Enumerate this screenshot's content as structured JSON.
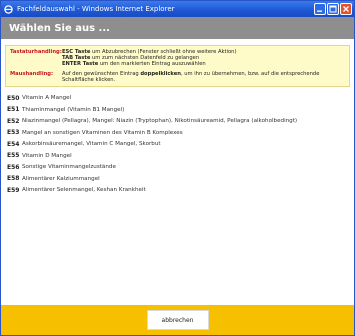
{
  "window": {
    "title": "Fachfeldauswahl - Windows Internet Explorer"
  },
  "header": {
    "title": "Wählen Sie aus ..."
  },
  "instructions": {
    "keyboard": {
      "heading": "Tastaturhandling:",
      "line1_key": "ESC Taste",
      "line1_text": " um Abzubrechen (Fenster schließt ohne weitere Aktion)",
      "line2_key": "TAB Taste",
      "line2_text": " um zum nächsten Datenfeld zu gelangen",
      "line3_key": "ENTER Taste",
      "line3_text": " um den markierten Eintrag auszuwählen"
    },
    "mouse": {
      "heading": "Maushandling:",
      "text1": "Auf den gewünschten Eintrag ",
      "key": "doppelklicken",
      "text2": ", um ihn zu übernehmen, bzw. auf die entsprechende Schaltfläche klicken."
    }
  },
  "items": [
    {
      "code": "E50",
      "desc": "Vitamin A Mangel"
    },
    {
      "code": "E51",
      "desc": "Thiaminmangel (Vitamin B1 Mangel)"
    },
    {
      "code": "E52",
      "desc": "Niazinmangel (Pellagra), Mangel: Niazin (Tryptophan), Nikotinsäureamid, Pellagra (alkoholbedingt)"
    },
    {
      "code": "E53",
      "desc": "Mangel an sonstigen Vitaminen des Vitamin B Komplexes"
    },
    {
      "code": "E54",
      "desc": "Askorbinsäuremangel, Vitamin C Mangel, Skorbut"
    },
    {
      "code": "E55",
      "desc": "Vitamin D Mangel"
    },
    {
      "code": "E56",
      "desc": "Sonstige Vitaminmangelzustände"
    },
    {
      "code": "E58",
      "desc": "Alimentärer Kalziummangel"
    },
    {
      "code": "E59",
      "desc": "Alimentärer Selenmangel, Keshan Krankheit"
    }
  ],
  "footer": {
    "cancel_label": "abbrechen"
  },
  "colors": {
    "header_bg": "#8e8e8e",
    "instructions_bg": "#fffbc8",
    "instruction_heading": "#c21b1b",
    "footer_bg": "#f6c000"
  },
  "icons": [
    "ie-icon",
    "minimize-icon",
    "maximize-icon",
    "close-icon"
  ]
}
